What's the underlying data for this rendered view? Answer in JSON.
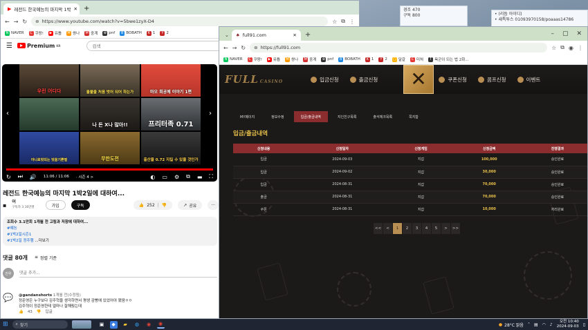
{
  "desktop": {
    "note1": {
      "line1": "경조 470",
      "line2": "구독 800"
    },
    "note2": {
      "line1": "• (리듬 아이디)",
      "line2": "• 새특투스 01093970158/poaaas14786"
    }
  },
  "youtube_window": {
    "tab": {
      "title": "레전드 한국예능의 마지막 1박",
      "new_tab": "+"
    },
    "url": "https://www.youtube.com/watch?v=5bwe1zyX-D4",
    "header": {
      "logo_text": "Premium",
      "logo_sup": "KR",
      "search_placeholder": "검색"
    },
    "thumbs": [
      "우린 어디다",
      "올불을 처음 벗어 되어 하는가",
      "마오 희공께 이야기 1편",
      "",
      "나 돈 X나 많아!!",
      "프리터족 0.71",
      "아니로벗되는 벗을기쁜벌",
      "무한도전",
      "출산율 0.72 지킬 수 있을 것인가"
    ],
    "time": "11:06 / 11:06",
    "chapter": "· 시즌 4 >",
    "title": "레전드 한국예능의 마지막 1박2일에 대하여...",
    "channel": {
      "name": "어",
      "subs": "구독자 3.16만명",
      "join": "가입",
      "subscribe": "구독"
    },
    "likes": "252",
    "share": "공유",
    "more": "···",
    "description": {
      "meta": "조회수 3.1만회  1개월 전  고림과 저장에 대하여...",
      "tag1": "#예능",
      "tag2": "#1박2일시즌1",
      "tag3": "#1박2일 정주행",
      "more": "...더보기"
    },
    "comments": {
      "title": "댓글 80개",
      "sort": "정렬 기준",
      "add_placeholder": "댓글 추가...",
      "my_avatar": "진우",
      "author": "@gandanshorts",
      "date": "1개월 전(수정됨)",
      "text1": "정준영은 누구보다 김주혁을 생각하면서 평생 감빵에 있었어야 됐음ㅇㅇ",
      "text2": "김주혁이 정준영한테 얼마나 잘해줬는데",
      "likes": "43",
      "reply": "답글"
    }
  },
  "casino_window": {
    "tab": {
      "title": "full91.com",
      "new_tab": "+"
    },
    "url": "https://full91.com",
    "bookmarks": [
      "NAVER",
      "쿠팡!",
      "유튭",
      "쌍나",
      "중계",
      "pnf",
      "BOBATH",
      "1",
      "2",
      "달갈",
      "미쳐",
      "욕군이 되는 법 2화..."
    ],
    "logo": {
      "main": "FULL",
      "sub": "CASINO"
    },
    "menu": [
      "입금신청",
      "출금신청",
      "쿠폰신청",
      "콤프신청",
      "이벤트"
    ],
    "close_glyph": "✕",
    "subtabs": [
      "MY페이지",
      "정보수정",
      "입금/출금내역",
      "지인친구목록",
      "출석체크목록",
      "쪽지함"
    ],
    "active_subtab": "입금/출금내역",
    "section_title": "입금/출금내역",
    "table": {
      "headers": [
        "신청내용",
        "신청일자",
        "신청게임",
        "신청금액",
        "진행결과"
      ],
      "rows": [
        [
          "입금",
          "2024-09-03",
          "지갑",
          "100,000",
          "승인완료"
        ],
        [
          "입금",
          "2024-09-02",
          "지갑",
          "30,000",
          "승인완료"
        ],
        [
          "입금",
          "2024-08-31",
          "지갑",
          "70,000",
          "승인완료"
        ],
        [
          "출금",
          "2024-08-31",
          "지갑",
          "70,000",
          "승인완료"
        ],
        [
          "쿠폰",
          "2024-08-31",
          "지갑",
          "10,000",
          "처리완료"
        ]
      ]
    },
    "pager": [
      "<<",
      "<",
      "1",
      "2",
      "3",
      "4",
      "5",
      ">",
      ">>"
    ],
    "active_page": "1"
  },
  "taskbar": {
    "search": "찾기",
    "weather": "28°C  맑음",
    "time": "오전 10:40",
    "date": "2024-09-03"
  }
}
